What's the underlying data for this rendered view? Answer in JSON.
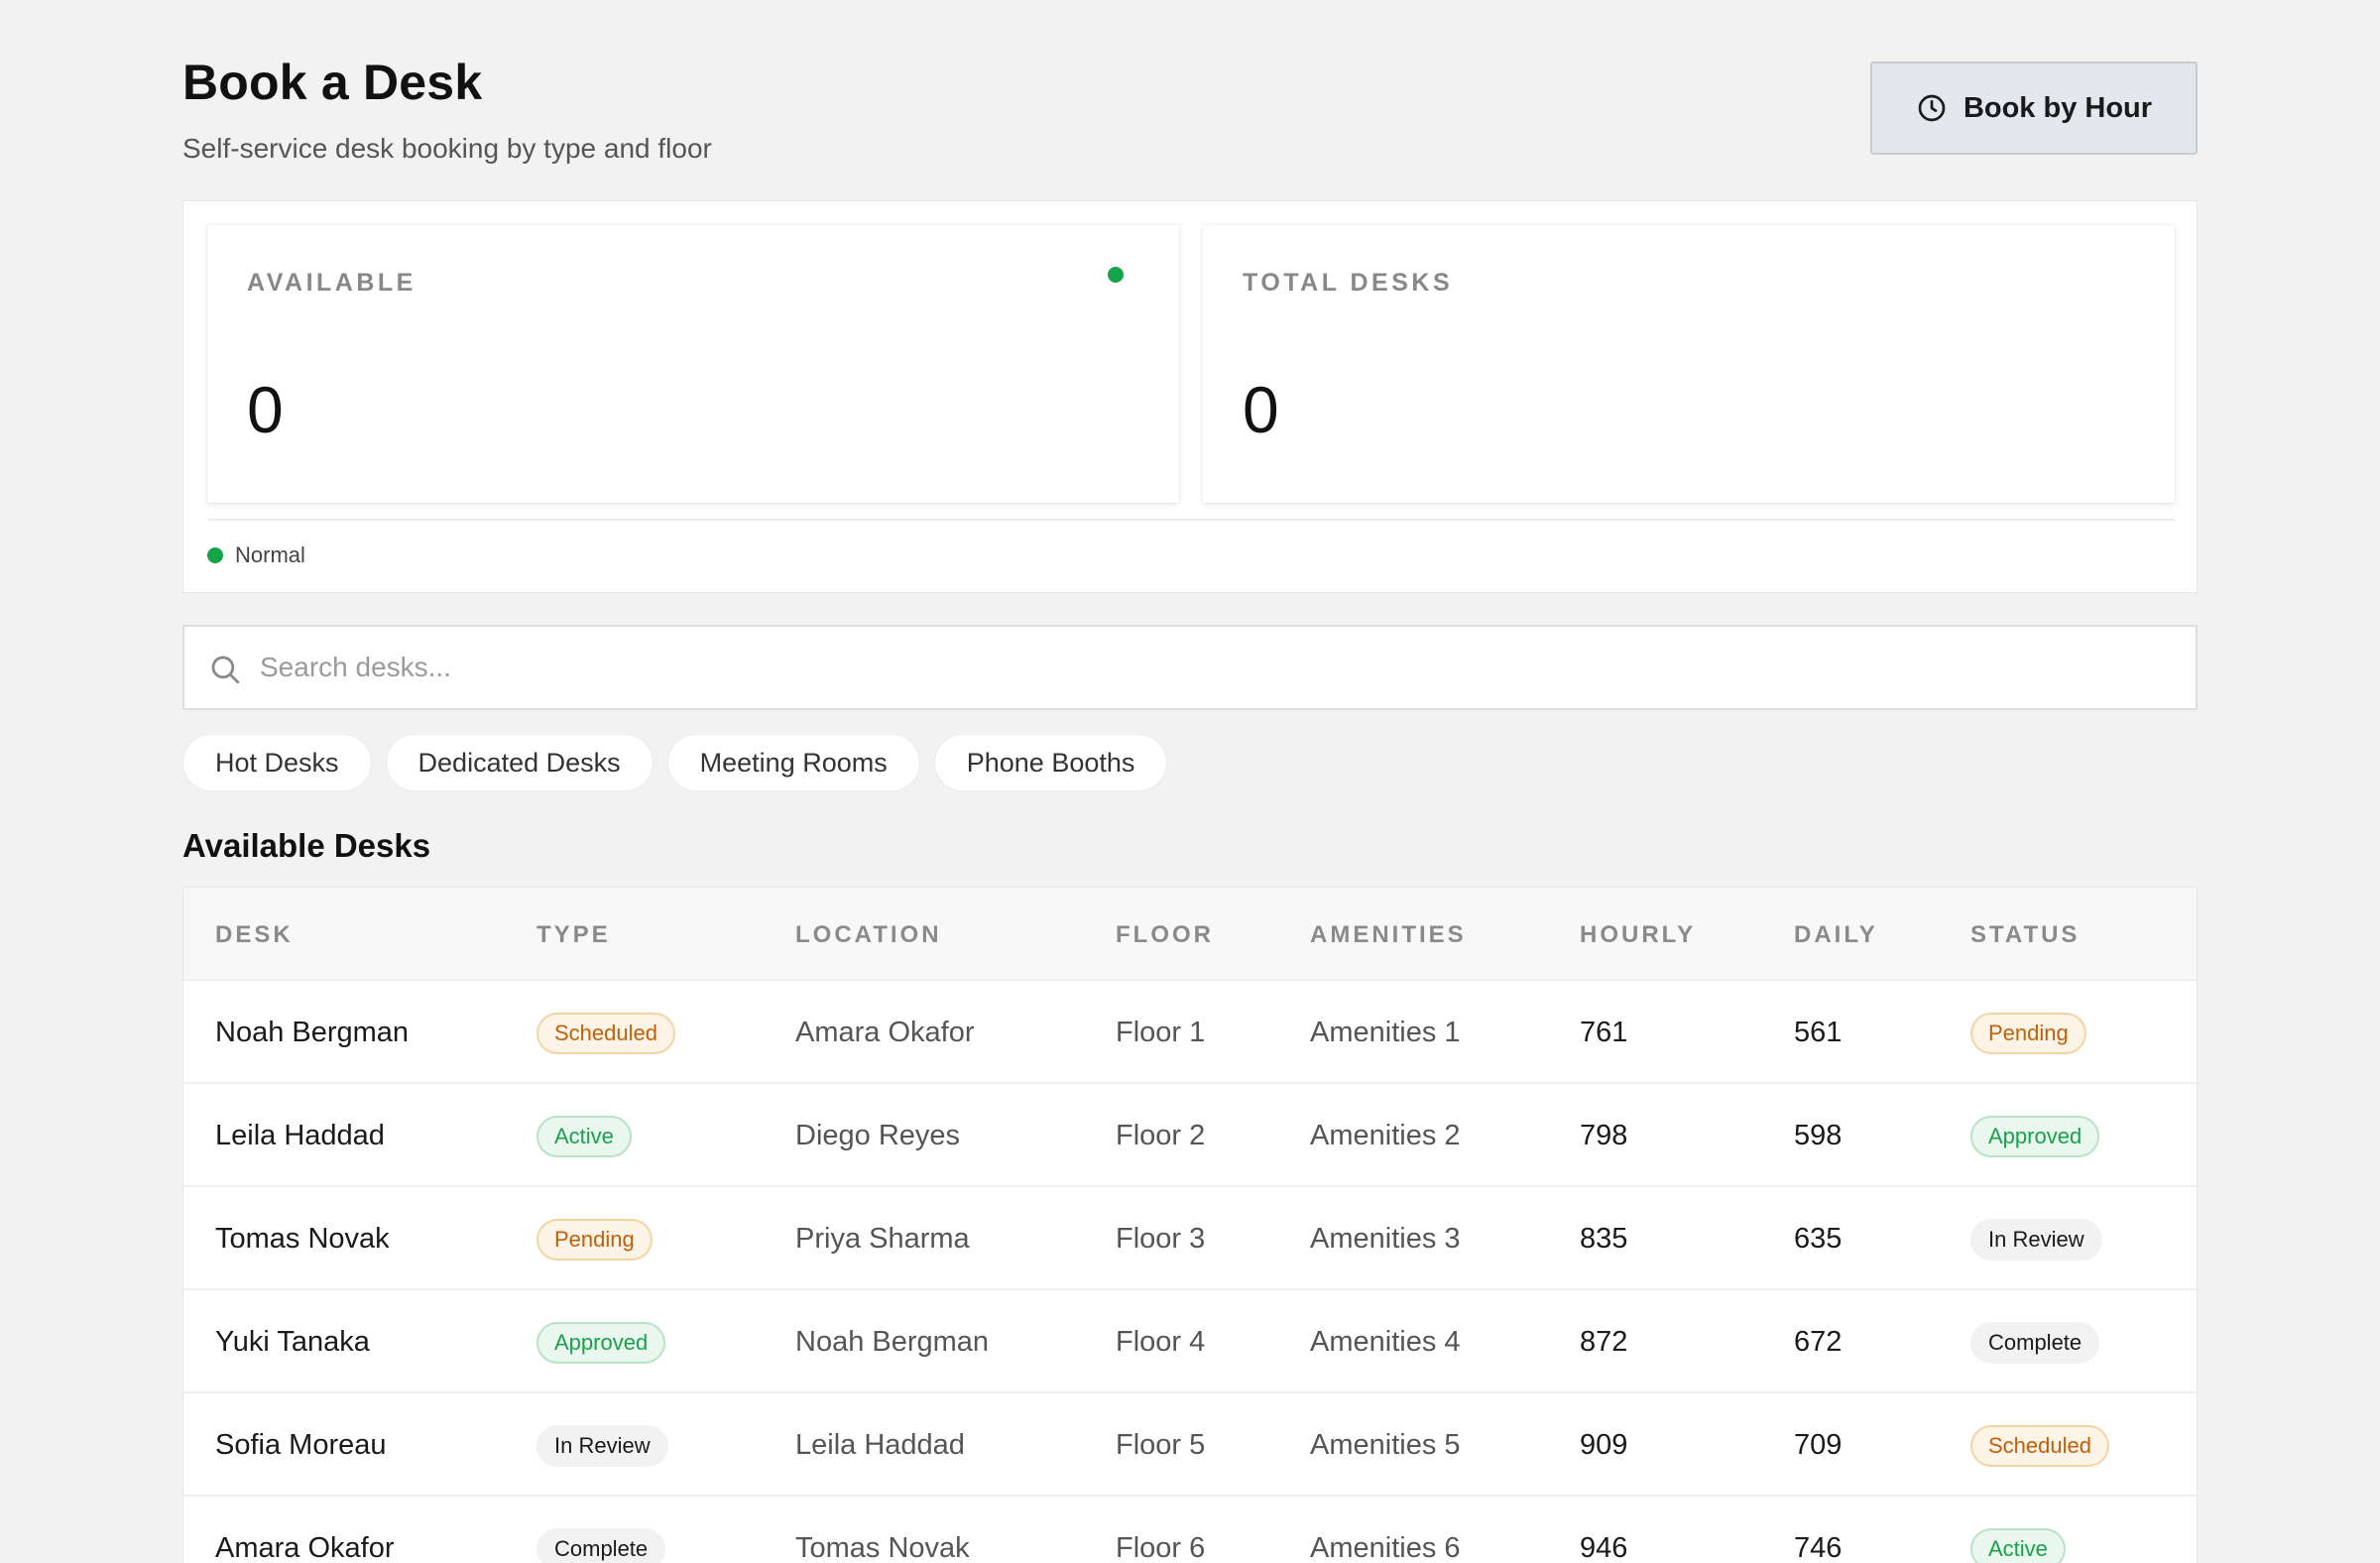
{
  "header": {
    "title": "Book a Desk",
    "subtitle": "Self-service desk booking by type and floor",
    "book_button_label": "Book by Hour",
    "book_button_icon": "clock-icon"
  },
  "stats": {
    "available": {
      "label": "AVAILABLE",
      "value": "0",
      "status_color": "#16a34a"
    },
    "total": {
      "label": "TOTAL DESKS",
      "value": "0"
    },
    "legend": {
      "label": "Normal",
      "color": "#16a34a"
    }
  },
  "search": {
    "placeholder": "Search desks...",
    "value": ""
  },
  "filters": [
    "Hot Desks",
    "Dedicated Desks",
    "Meeting Rooms",
    "Phone Booths"
  ],
  "section_title": "Available Desks",
  "table": {
    "columns": [
      "DESK",
      "TYPE",
      "LOCATION",
      "FLOOR",
      "AMENITIES",
      "HOURLY",
      "DAILY",
      "STATUS"
    ],
    "rows": [
      {
        "desk": "Noah Bergman",
        "type": "Scheduled",
        "location": "Amara Okafor",
        "floor": "Floor 1",
        "amenities": "Amenities 1",
        "hourly": "761",
        "daily": "561",
        "status": "Pending"
      },
      {
        "desk": "Leila Haddad",
        "type": "Active",
        "location": "Diego Reyes",
        "floor": "Floor 2",
        "amenities": "Amenities 2",
        "hourly": "798",
        "daily": "598",
        "status": "Approved"
      },
      {
        "desk": "Tomas Novak",
        "type": "Pending",
        "location": "Priya Sharma",
        "floor": "Floor 3",
        "amenities": "Amenities 3",
        "hourly": "835",
        "daily": "635",
        "status": "In Review"
      },
      {
        "desk": "Yuki Tanaka",
        "type": "Approved",
        "location": "Noah Bergman",
        "floor": "Floor 4",
        "amenities": "Amenities 4",
        "hourly": "872",
        "daily": "672",
        "status": "Complete"
      },
      {
        "desk": "Sofia Moreau",
        "type": "In Review",
        "location": "Leila Haddad",
        "floor": "Floor 5",
        "amenities": "Amenities 5",
        "hourly": "909",
        "daily": "709",
        "status": "Scheduled"
      },
      {
        "desk": "Amara Okafor",
        "type": "Complete",
        "location": "Tomas Novak",
        "floor": "Floor 6",
        "amenities": "Amenities 6",
        "hourly": "946",
        "daily": "746",
        "status": "Active"
      }
    ]
  },
  "badge_colors": {
    "Scheduled": "orange",
    "Pending": "orange",
    "Active": "green",
    "Approved": "green",
    "In Review": "gray",
    "Complete": "gray"
  }
}
